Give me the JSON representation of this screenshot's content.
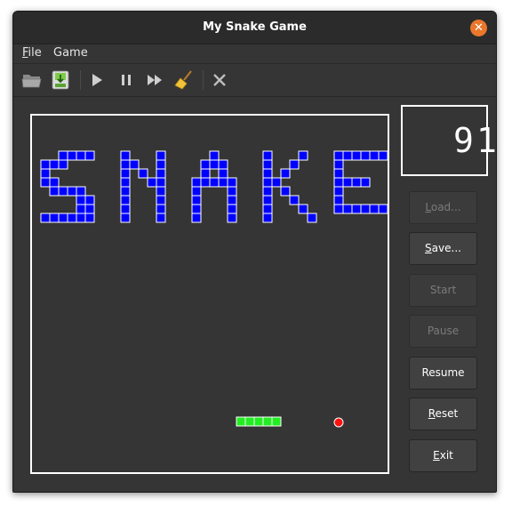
{
  "window": {
    "title": "My Snake Game"
  },
  "menu": [
    {
      "label": "File",
      "mnemonic": "F",
      "rest": "ile"
    },
    {
      "label": "Game",
      "mnemonic": "",
      "rest": "Game"
    }
  ],
  "toolbar": {
    "items": [
      "open-icon",
      "save-icon",
      "play-icon",
      "pause-icon",
      "fast-forward-icon",
      "broom-icon",
      "close-icon"
    ]
  },
  "score": {
    "value": "91",
    "shown": "9 1"
  },
  "buttons": [
    {
      "id": "load",
      "mnemonic": "L",
      "rest": "oad...",
      "label": "Load...",
      "enabled": false
    },
    {
      "id": "save",
      "mnemonic": "S",
      "rest": "ave...",
      "label": "Save...",
      "enabled": true
    },
    {
      "id": "start",
      "mnemonic": "",
      "rest": "Start",
      "label": "Start",
      "enabled": false
    },
    {
      "id": "pause",
      "mnemonic": "",
      "rest": "Pause",
      "label": "Pause",
      "enabled": false
    },
    {
      "id": "resume",
      "mnemonic": "",
      "rest": "Resume",
      "label": "Resume",
      "enabled": true
    },
    {
      "id": "reset",
      "mnemonic": "R",
      "rest": "eset",
      "label": "Reset",
      "enabled": true
    },
    {
      "id": "exit",
      "mnemonic": "E",
      "rest": "xit",
      "label": "Exit",
      "enabled": true
    }
  ],
  "colors": {
    "wall": "#0000ff",
    "wall_border": "#ffffff",
    "snake": "#22ee22",
    "food": "#ff1111",
    "board_bg": "#353535",
    "accent": "#e9772c"
  },
  "game": {
    "walls_title_word": "SNAKE",
    "snake_length": 5,
    "food_count": 1
  }
}
